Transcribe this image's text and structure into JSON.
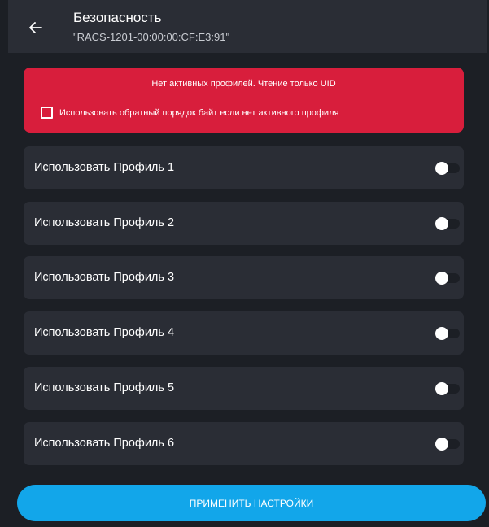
{
  "header": {
    "title": "Безопасность",
    "subtitle": "\"RACS-1201-00:00:00:CF:E3:91\"",
    "back_icon": "arrow-left-icon"
  },
  "alert": {
    "message": "Нет активных профилей. Чтение только UID",
    "checkbox_label": "Использовать обратный порядок байт если нет активного профиля",
    "checkbox_checked": false,
    "color": "#d81e3c"
  },
  "profiles": [
    {
      "label": "Использовать Профиль 1",
      "enabled": false
    },
    {
      "label": "Использовать Профиль 2",
      "enabled": false
    },
    {
      "label": "Использовать Профиль 3",
      "enabled": false
    },
    {
      "label": "Использовать Профиль 4",
      "enabled": false
    },
    {
      "label": "Использовать Профиль 5",
      "enabled": false
    },
    {
      "label": "Использовать Профиль 6",
      "enabled": false
    }
  ],
  "apply_button": {
    "label": "ПРИМЕНИТЬ НАСТРОЙКИ",
    "color": "#12a6ea"
  }
}
